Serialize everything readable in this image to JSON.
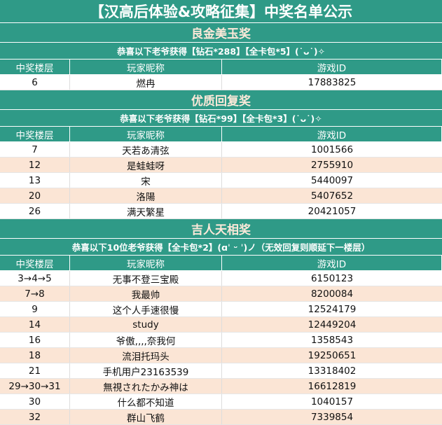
{
  "title": "【汉高后体验&攻略征集】中奖名单公示",
  "columns": [
    "中奖楼层",
    "玩家昵称",
    "游戏ID"
  ],
  "sections": [
    {
      "name": "良金美玉奖",
      "subtitle": "恭喜以下老爷获得【钻石*288】【全卡包*5】(˙ᴗ˙)✧",
      "rows": [
        [
          "6",
          "燃冉",
          "17883825"
        ]
      ]
    },
    {
      "name": "优质回复奖",
      "subtitle": "恭喜以下老爷获得【钻石*99】【全卡包*3】(˙ᴗ˙)✧",
      "rows": [
        [
          "7",
          "天若あ清弦",
          "1001566"
        ],
        [
          "12",
          "是蛙蛙呀",
          "2755910"
        ],
        [
          "13",
          "宋",
          "5440097"
        ],
        [
          "20",
          "洛陽",
          "5407652"
        ],
        [
          "26",
          "满天繁星",
          "20421057"
        ]
      ]
    },
    {
      "name": "吉人天相奖",
      "subtitle": "恭喜以下10位老爷获得【全卡包*2】(ɑˈ ᵕ ˈ)ノ（无效回复则顺延下一楼层）",
      "rows": [
        [
          "3→4→5",
          "无事不登三宝殿",
          "6150123"
        ],
        [
          "7→8",
          "我最帅",
          "8200084"
        ],
        [
          "9",
          "这个人手速很慢",
          "12524179"
        ],
        [
          "14",
          "study",
          "12449204"
        ],
        [
          "16",
          "爷傲,,,,奈我何",
          "1358543"
        ],
        [
          "18",
          "流泪托玛头",
          "19250651"
        ],
        [
          "21",
          "手机用户23163539",
          "13318402"
        ],
        [
          "29→30→31",
          "無視されたかみ神は",
          "16612819"
        ],
        [
          "30",
          "什么都不知道",
          "1040157"
        ],
        [
          "32",
          "群山飞鹤",
          "7339854"
        ]
      ]
    }
  ]
}
